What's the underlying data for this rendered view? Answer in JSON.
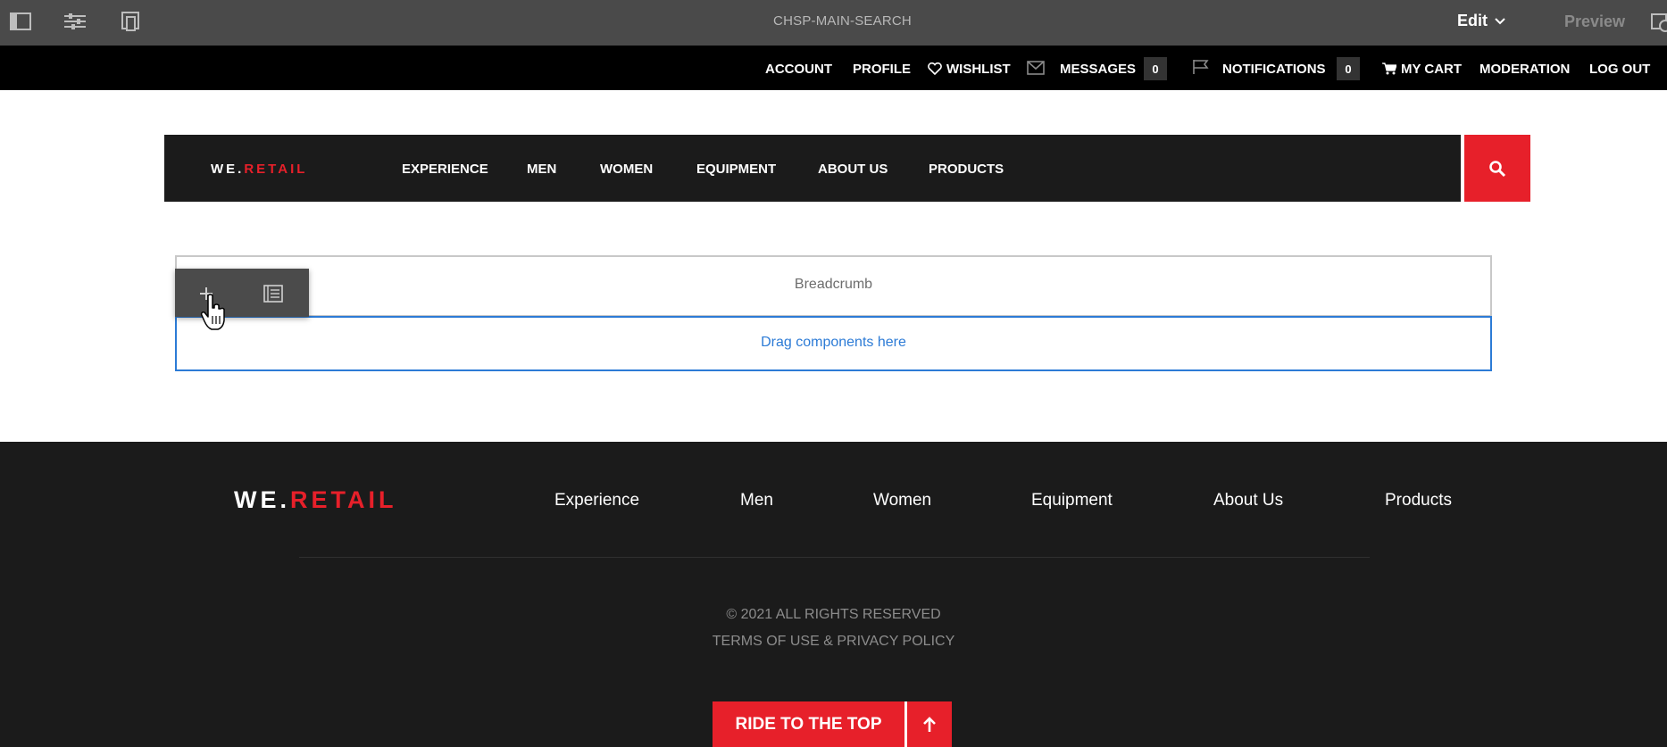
{
  "editor": {
    "page_title": "CHSP-MAIN-SEARCH",
    "mode_label": "Edit",
    "preview_label": "Preview",
    "tools": [
      "side-panel-icon",
      "page-properties-icon",
      "emulator-icon"
    ]
  },
  "user_bar": {
    "account": "ACCOUNT",
    "profile": "PROFILE",
    "wishlist": "WISHLIST",
    "messages": "MESSAGES",
    "messages_count": "0",
    "notifications": "NOTIFICATIONS",
    "notifications_count": "0",
    "cart": "MY CART",
    "moderation": "MODERATION",
    "logout": "LOG OUT"
  },
  "nav": {
    "logo_white": "WE.",
    "logo_red": "RETAIL",
    "links": [
      "EXPERIENCE",
      "MEN",
      "WOMEN",
      "EQUIPMENT",
      "ABOUT US",
      "PRODUCTS"
    ]
  },
  "content": {
    "breadcrumb_label": "Breadcrumb",
    "drop_label": "Drag components here"
  },
  "footer": {
    "logo_white": "WE.",
    "logo_red": "RETAIL",
    "links": [
      "Experience",
      "Men",
      "Women",
      "Equipment",
      "About Us",
      "Products"
    ],
    "copyright": "© 2021 ALL RIGHTS RESERVED",
    "terms": "TERMS OF USE & PRIVACY POLICY",
    "top_button": "RIDE TO THE TOP"
  },
  "colors": {
    "accent": "#e7202a",
    "editor_bar": "#4a4a4a",
    "nav_bg": "#1b1b1b",
    "drop_border": "#2c7bd6"
  }
}
